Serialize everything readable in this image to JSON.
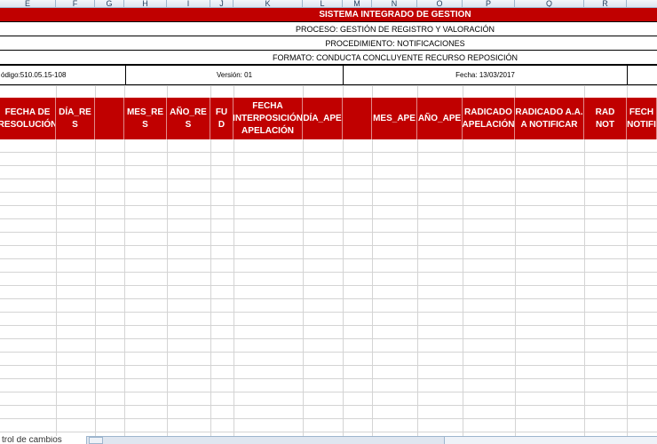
{
  "columns": [
    "E",
    "F",
    "G",
    "H",
    "I",
    "J",
    "K",
    "L",
    "M",
    "N",
    "O",
    "P",
    "Q",
    "R"
  ],
  "title_block": {
    "system": "SISTEMA INTEGRADO DE GESTION",
    "process": "PROCESO: GESTIÓN DE REGISTRO Y VALORACIÓN",
    "procedure": "PROCEDIMIENTO: NOTIFICACIONES",
    "format": "FORMATO: CONDUCTA CONCLUYENTE RECURSO REPOSICIÓN",
    "code": "ódigo:510.05.15-108",
    "version": "Versión: 01",
    "date": "Fecha: 13/03/2017"
  },
  "headers": [
    "FECHA DE\nRESOLUCIÓN",
    "DÍA_RE\nS",
    "",
    "MES_RE\nS",
    "AÑO_RE\nS",
    "FU\nD",
    "FECHA\nINTERPOSICIÓN\nAPELACIÓN",
    "DÍA_APE",
    "",
    "MES_APE",
    "AÑO_APE",
    "RADICADO\nAPELACIÓN",
    "RADICADO A.A.\nA NOTIFICAR",
    "RAD\nNOT",
    "FECH\nNOTIFI"
  ],
  "sheet_tab": "trol de cambios",
  "colors": {
    "header_red": "#c00000",
    "grid": "#d4d4d4"
  }
}
